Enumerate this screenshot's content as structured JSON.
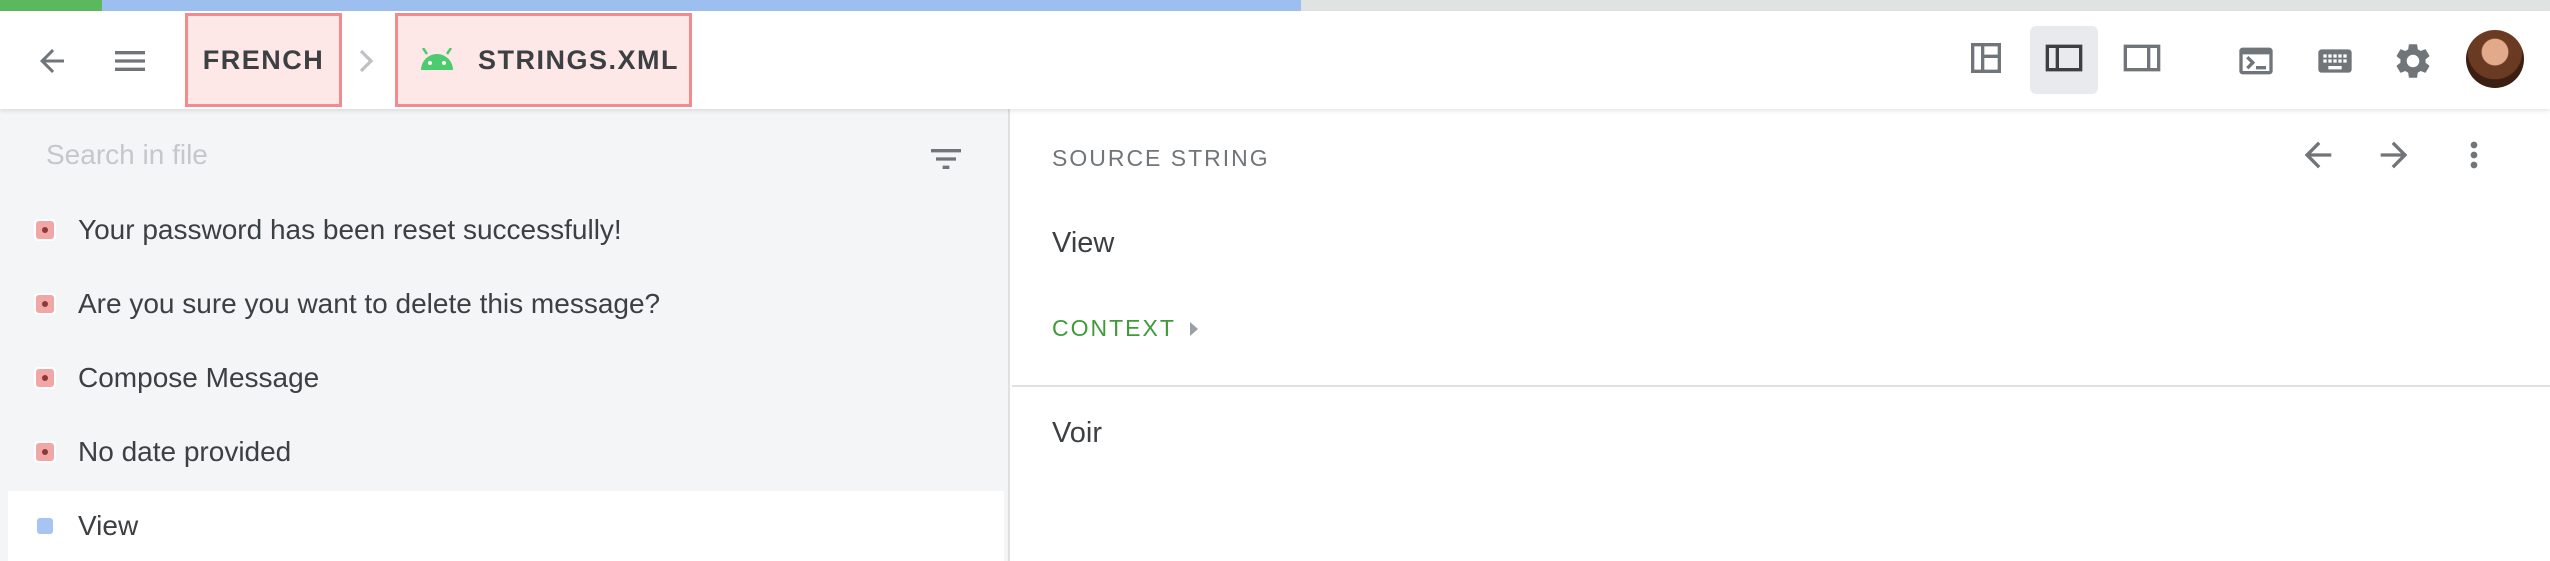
{
  "progress": {
    "translated_fraction": 0.04,
    "approved_fraction": 0.51
  },
  "breadcrumb": {
    "language": "FRENCH",
    "file": "STRINGS.XML",
    "file_icon": "android-icon"
  },
  "toolbar": {
    "icons": [
      "back-arrow-icon",
      "hamburger-menu-icon",
      "layout-split-icon",
      "layout-left-panel-icon",
      "layout-right-panel-icon",
      "terminal-icon",
      "keyboard-icon",
      "gear-icon",
      "avatar"
    ],
    "active_layout": "layout-left-panel"
  },
  "search": {
    "placeholder": "Search in file",
    "value": ""
  },
  "strings": [
    {
      "text": "Your password has been reset successfully!",
      "status": "untranslated"
    },
    {
      "text": "Are you sure you want to delete this message?",
      "status": "untranslated"
    },
    {
      "text": "Compose Message",
      "status": "untranslated"
    },
    {
      "text": "No date provided",
      "status": "untranslated"
    },
    {
      "text": "View",
      "status": "translated",
      "selected": true
    }
  ],
  "editor": {
    "source_label": "SOURCE STRING",
    "source_text": "View",
    "context_label": "CONTEXT",
    "translation_text": "Voir"
  },
  "colors": {
    "accent_green": "#3f9b39",
    "highlight_red": "#f28b8b",
    "progress_green": "#5cb85c",
    "progress_blue": "#9dbff0"
  }
}
